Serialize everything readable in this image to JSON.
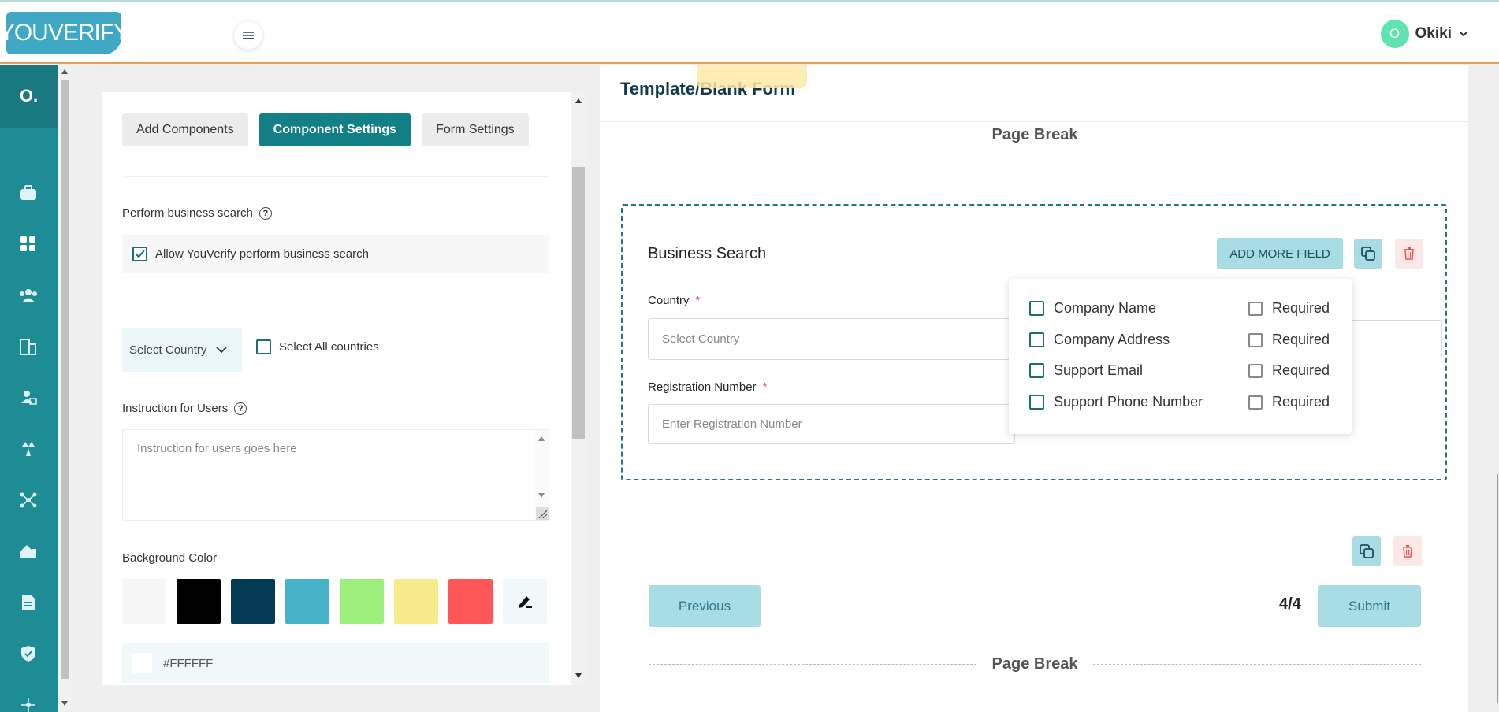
{
  "header": {
    "logo_text": "YOUVERIFY",
    "user_initial": "O",
    "user_name": "Okiki"
  },
  "sidebar": {
    "head_text": "O.",
    "icons": [
      "briefcase-icon",
      "dashboard-icon",
      "users-icon",
      "buildings-icon",
      "person-card-icon",
      "balance-icon",
      "network-icon",
      "home-office-icon",
      "document-icon",
      "shield-icon",
      "hub-icon"
    ]
  },
  "panel": {
    "tabs": [
      "Add Components",
      "Component Settings",
      "Form Settings"
    ],
    "business_search_label": "Perform business search",
    "allow_label": "Allow YouVerify perform business search",
    "select_country": "Select Country",
    "select_all": "Select All countries",
    "instruction_label": "Instruction for Users",
    "instruction_placeholder": "Instruction for users goes here",
    "bg_color_label": "Background Color",
    "swatches": [
      "#f7f7f7",
      "#000000",
      "#053a55",
      "#45b2c9",
      "#9bef7a",
      "#f7ea8a",
      "#ff5757"
    ],
    "hex_value": "#FFFFFF"
  },
  "canvas": {
    "page_title": "Template/Blank Form",
    "page_break": "Page Break",
    "section_title": "Business Search",
    "add_more_field": "ADD MORE FIELD",
    "country_label": "Country",
    "country_placeholder": "Select Country",
    "reg_label": "Registration Number",
    "reg_placeholder": "Enter Registration Number",
    "dropdown_fields": [
      "Company Name",
      "Company Address",
      "Support Email",
      "Support Phone Number"
    ],
    "required_label": "Required",
    "previous": "Previous",
    "page_indicator": "4/4",
    "submit": "Submit"
  }
}
